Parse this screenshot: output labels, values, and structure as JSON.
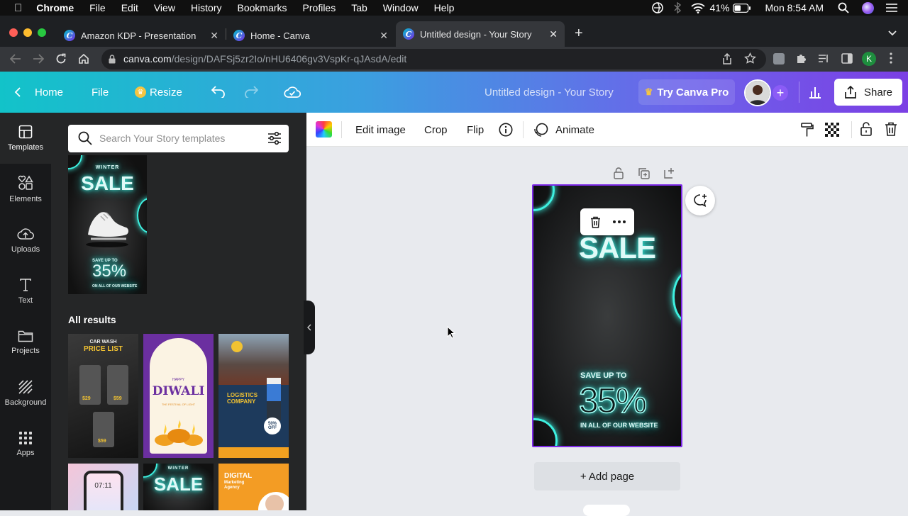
{
  "menubar": {
    "app": "Chrome",
    "items": [
      "File",
      "Edit",
      "View",
      "History",
      "Bookmarks",
      "Profiles",
      "Tab",
      "Window",
      "Help"
    ],
    "battery": "41%",
    "clock": "Mon 8:54 AM"
  },
  "tabs": [
    {
      "title": "Amazon KDP - Presentation"
    },
    {
      "title": "Home - Canva"
    },
    {
      "title": "Untitled design - Your Story"
    }
  ],
  "address": {
    "domain": "canva.com",
    "path": "/design/DAFSj5zr2Io/nHU6406gv3VspKr-qJAsdA/edit",
    "profile_initial": "K"
  },
  "header": {
    "home_label": "Home",
    "file_label": "File",
    "resize_label": "Resize",
    "design_title": "Untitled design - Your Story",
    "try_pro_label": "Try Canva Pro",
    "share_label": "Share"
  },
  "rail": [
    {
      "label": "Templates",
      "icon": "templates-icon"
    },
    {
      "label": "Elements",
      "icon": "elements-icon"
    },
    {
      "label": "Uploads",
      "icon": "uploads-icon"
    },
    {
      "label": "Text",
      "icon": "text-icon"
    },
    {
      "label": "Projects",
      "icon": "projects-icon"
    },
    {
      "label": "Background",
      "icon": "background-icon"
    },
    {
      "label": "Apps",
      "icon": "apps-icon"
    }
  ],
  "panel": {
    "search_placeholder": "Search Your Story templates",
    "all_results_label": "All results",
    "featured": {
      "line1": "WINTER",
      "line2": "SALE",
      "line3": "SAVE UP TO",
      "line4": "35%",
      "line5": "ON ALL OF OUR WEBSITE"
    },
    "templates": [
      {
        "name": "car-wash-price-list",
        "title": "CAR WASH",
        "subtitle": "PRICE LIST",
        "prices": [
          "$29",
          "$59",
          "$59"
        ]
      },
      {
        "name": "diwali",
        "line1": "HAPPY",
        "line2": "DIWALI",
        "line3": "THE FESTIVAL OF LIGHT"
      },
      {
        "name": "logistics-company",
        "line1": "LOGISTICS",
        "line2": "COMPANY",
        "badge_pct": "50%",
        "badge_txt": "OFF"
      },
      {
        "name": "phone-lockscreen",
        "time": "07:11"
      },
      {
        "name": "winter-sale",
        "line1": "WINTER",
        "line2": "SALE"
      },
      {
        "name": "digital-marketing",
        "line1": "DIGITAL",
        "line2": "Marketing",
        "line3": "Agency"
      }
    ]
  },
  "toolbar": {
    "edit_image_label": "Edit image",
    "crop_label": "Crop",
    "flip_label": "Flip",
    "animate_label": "Animate"
  },
  "canvas": {
    "headline": "SALE",
    "save_label": "SAVE UP TO",
    "percent": "35%",
    "website_label": "IN ALL OF OUR WEBSITE",
    "add_page_label": "+ Add page"
  },
  "colors": {
    "accent": "#7d2ae8",
    "neon": "#3ef0e0",
    "pro_crown": "#f5c542"
  }
}
